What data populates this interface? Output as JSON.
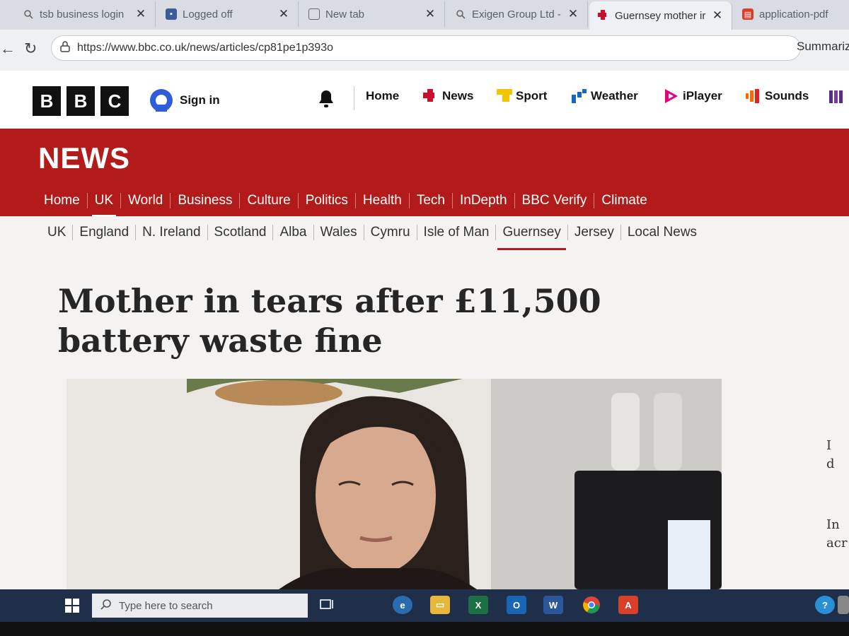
{
  "browser": {
    "tabs": [
      {
        "label": "tsb business login",
        "icon": "search-icon",
        "active": false
      },
      {
        "label": "Logged off",
        "icon": "bbc-favicon-icon",
        "active": false
      },
      {
        "label": "New tab",
        "icon": "new-tab-icon",
        "active": false
      },
      {
        "label": "Exigen Group Ltd -",
        "icon": "search-icon",
        "active": false
      },
      {
        "label": "Guernsey mother ir",
        "icon": "bbc-news-favicon-icon",
        "active": true
      },
      {
        "label": "application-pdf",
        "icon": "pdf-icon",
        "active": false
      }
    ],
    "url": "https://www.bbc.co.uk/news/articles/cp81pe1p393o",
    "summarize_label": "Summariz"
  },
  "bbc_header": {
    "logo_letters": [
      "B",
      "B",
      "C"
    ],
    "sign_in": "Sign in",
    "nav": [
      {
        "label": "Home",
        "icon": ""
      },
      {
        "label": "News",
        "icon": "news-icon"
      },
      {
        "label": "Sport",
        "icon": "sport-icon"
      },
      {
        "label": "Weather",
        "icon": "weather-icon"
      },
      {
        "label": "iPlayer",
        "icon": "iplayer-icon"
      },
      {
        "label": "Sounds",
        "icon": "sounds-icon"
      }
    ]
  },
  "news_banner": {
    "title": "NEWS",
    "sections": [
      "Home",
      "UK",
      "World",
      "Business",
      "Culture",
      "Politics",
      "Health",
      "Tech",
      "InDepth",
      "BBC Verify",
      "Climate"
    ],
    "current_section": "UK"
  },
  "sub_nav": {
    "items": [
      "UK",
      "England",
      "N. Ireland",
      "Scotland",
      "Alba",
      "Wales",
      "Cymru",
      "Isle of Man",
      "Guernsey",
      "Jersey",
      "Local News"
    ],
    "current": "Guernsey"
  },
  "article": {
    "headline": "Mother in tears after £11,500 battery waste fine",
    "side_text": [
      "I",
      "d",
      "In",
      "acr"
    ]
  },
  "taskbar": {
    "search_placeholder": "Type here to search"
  },
  "colors": {
    "bbc_news_red": "#b31b1b",
    "taskbar": "#1f2f4a"
  }
}
